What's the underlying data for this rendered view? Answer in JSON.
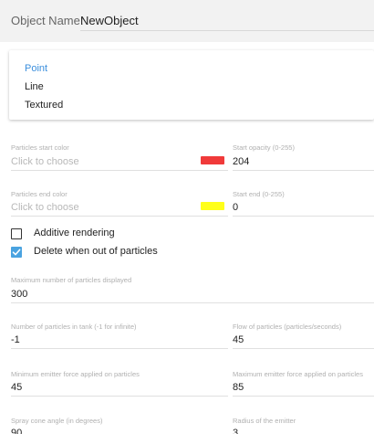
{
  "object_name": {
    "label": "Object Name:",
    "value": "NewObject"
  },
  "render_types": [
    "Point",
    "Line",
    "Textured"
  ],
  "selected_render_type": "Point",
  "particles_start_color": {
    "label": "Particles start color",
    "placeholder": "Click to choose",
    "color": "#f03a3a"
  },
  "start_opacity": {
    "label": "Start opacity (0-255)",
    "value": "204"
  },
  "particles_end_color": {
    "label": "Particles end color",
    "placeholder": "Click to choose",
    "color": "#ffff1a"
  },
  "start_end": {
    "label": "Start end (0-255)",
    "value": "0"
  },
  "additive_rendering": {
    "label": "Additive rendering",
    "checked": false
  },
  "delete_when_out": {
    "label": "Delete when out of particles",
    "checked": true
  },
  "max_particles": {
    "label": "Maximum number of particles displayed",
    "value": "300"
  },
  "particles_in_tank": {
    "label": "Number of particles in tank (-1 for infinite)",
    "value": "-1"
  },
  "flow": {
    "label": "Flow of particles (particles/seconds)",
    "value": "45"
  },
  "min_force": {
    "label": "Minimum emitter force applied on particles",
    "value": "45"
  },
  "max_force": {
    "label": "Maximum emitter force applied on particles",
    "value": "85"
  },
  "spray_angle": {
    "label": "Spray cone angle (in degrees)",
    "value": "90"
  },
  "emitter_radius": {
    "label": "Radius of the emitter",
    "value": "3"
  },
  "colors": {
    "accent": "#3c8fdd",
    "checkbox": "#4aa3e0"
  }
}
